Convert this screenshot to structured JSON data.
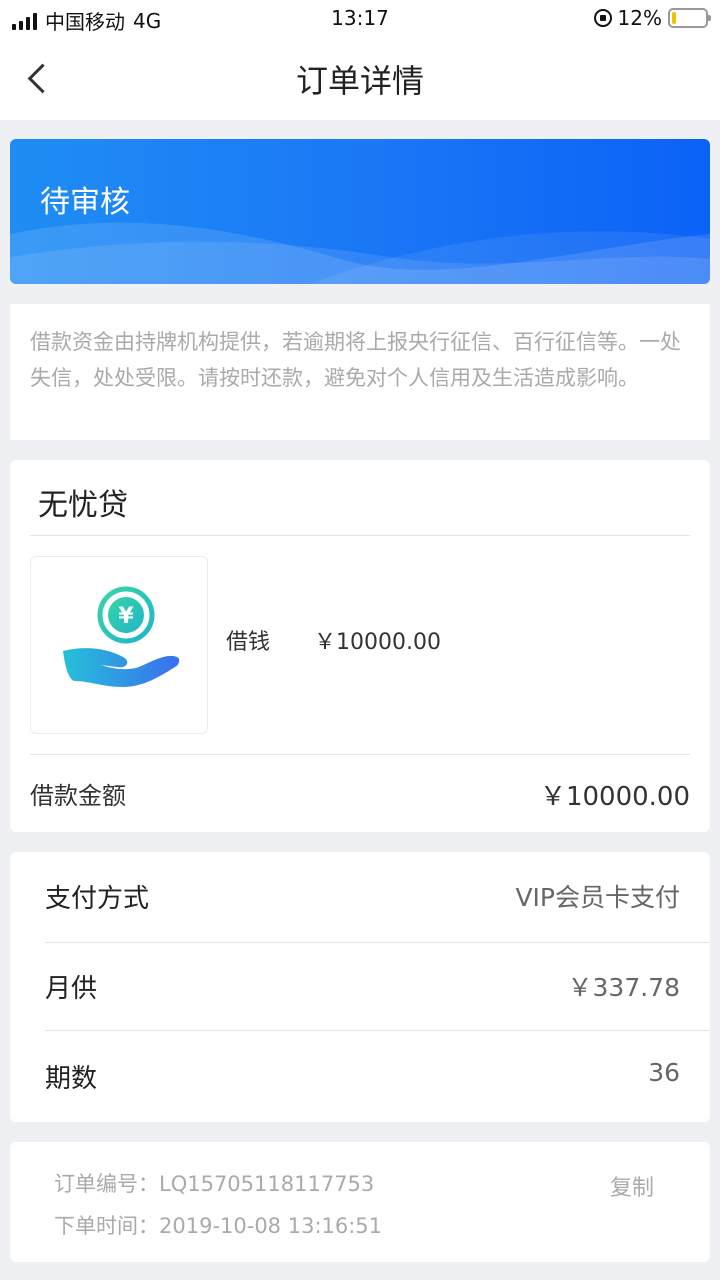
{
  "status_bar": {
    "carrier": "中国移动",
    "network": "4G",
    "time": "13:17",
    "battery": "12%",
    "battery_level": 0.12,
    "battery_color": "#f5c000"
  },
  "nav": {
    "title": "订单详情",
    "back_icon": "chevron-left-icon"
  },
  "banner": {
    "status": "待审核",
    "gradient_start": "#1f8df4",
    "gradient_end": "#0b62f7"
  },
  "notice": {
    "text": "借款资金由持牌机构提供，若逾期将上报央行征信、百行征信等。一处失信，处处受限。请按时还款，避免对个人信用及生活造成影响。"
  },
  "product": {
    "name": "无忧贷",
    "icon": "hand-coin-icon",
    "item_label": "借钱",
    "item_amount": "￥10000.00",
    "loan_label": "借款金额",
    "loan_value": "￥10000.00"
  },
  "payment": {
    "rows": [
      {
        "label": "支付方式",
        "value": "VIP会员卡支付"
      },
      {
        "label": "月供",
        "value": "￥337.78"
      },
      {
        "label": "期数",
        "value": "36"
      }
    ]
  },
  "order": {
    "number_label": "订单编号：",
    "number": "LQ15705118117753",
    "time_label": "下单时间：",
    "time": "2019-10-08 13:16:51",
    "copy_label": "复制"
  }
}
